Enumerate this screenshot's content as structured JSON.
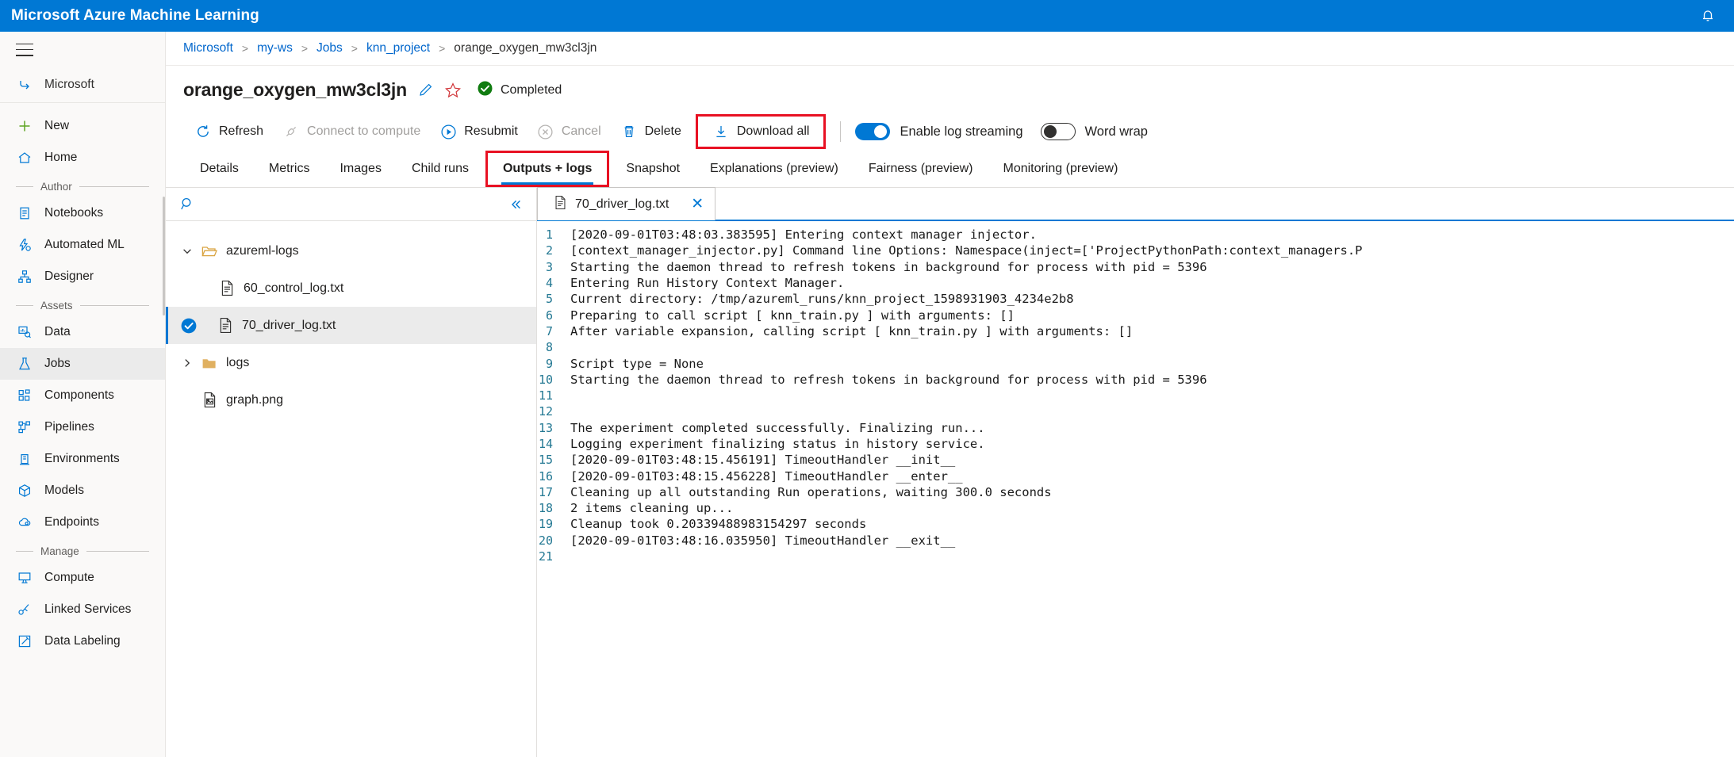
{
  "topbar": {
    "title": "Microsoft Azure Machine Learning",
    "notification_icon": "bell-icon"
  },
  "sidebar": {
    "menu_icon": "hamburger-icon",
    "back_label": "Microsoft",
    "items": [
      {
        "label": "New",
        "icon": "plus-icon"
      },
      {
        "label": "Home",
        "icon": "home-icon"
      }
    ],
    "groups": [
      {
        "caption": "Author",
        "items": [
          {
            "label": "Notebooks",
            "icon": "notebook-icon"
          },
          {
            "label": "Automated ML",
            "icon": "automated-ml-icon"
          },
          {
            "label": "Designer",
            "icon": "designer-icon"
          }
        ]
      },
      {
        "caption": "Assets",
        "items": [
          {
            "label": "Data",
            "icon": "data-icon"
          },
          {
            "label": "Jobs",
            "icon": "jobs-flask-icon"
          },
          {
            "label": "Components",
            "icon": "components-icon"
          },
          {
            "label": "Pipelines",
            "icon": "pipelines-icon"
          },
          {
            "label": "Environments",
            "icon": "environments-icon"
          },
          {
            "label": "Models",
            "icon": "models-cube-icon"
          },
          {
            "label": "Endpoints",
            "icon": "endpoints-cloud-icon"
          }
        ]
      },
      {
        "caption": "Manage",
        "items": [
          {
            "label": "Compute",
            "icon": "compute-monitor-icon"
          },
          {
            "label": "Linked Services",
            "icon": "linked-services-icon"
          },
          {
            "label": "Data Labeling",
            "icon": "data-labeling-icon"
          }
        ]
      }
    ],
    "active_item": "Jobs"
  },
  "breadcrumb": {
    "items": [
      "Microsoft",
      "my-ws",
      "Jobs",
      "knn_project",
      "orange_oxygen_mw3cl3jn"
    ],
    "separator": ">"
  },
  "job": {
    "title": "orange_oxygen_mw3cl3jn",
    "edit_icon": "pencil-icon",
    "favorite_icon": "star-icon",
    "status_label": "Completed",
    "status_icon": "check-circle-icon",
    "status_color": "#107c10"
  },
  "commandbar": {
    "buttons": [
      {
        "label": "Refresh",
        "icon": "refresh-icon",
        "disabled": false,
        "highlighted": false
      },
      {
        "label": "Connect to compute",
        "icon": "connect-compute-icon",
        "disabled": true,
        "highlighted": false
      },
      {
        "label": "Resubmit",
        "icon": "play-circle-icon",
        "disabled": false,
        "highlighted": false
      },
      {
        "label": "Cancel",
        "icon": "cancel-circle-icon",
        "disabled": true,
        "highlighted": false
      },
      {
        "label": "Delete",
        "icon": "trash-icon",
        "disabled": false,
        "highlighted": false
      },
      {
        "label": "Download all",
        "icon": "download-icon",
        "disabled": false,
        "highlighted": true
      }
    ],
    "highlight_color": "#e81123",
    "toggles": [
      {
        "label": "Enable log streaming",
        "state": "on"
      },
      {
        "label": "Word wrap",
        "state": "off"
      }
    ]
  },
  "tabs": {
    "items": [
      {
        "label": "Details",
        "active": false,
        "highlighted": false
      },
      {
        "label": "Metrics",
        "active": false,
        "highlighted": false
      },
      {
        "label": "Images",
        "active": false,
        "highlighted": false
      },
      {
        "label": "Child runs",
        "active": false,
        "highlighted": false
      },
      {
        "label": "Outputs + logs",
        "active": true,
        "highlighted": true
      },
      {
        "label": "Snapshot",
        "active": false,
        "highlighted": false
      },
      {
        "label": "Explanations (preview)",
        "active": false,
        "highlighted": false
      },
      {
        "label": "Fairness (preview)",
        "active": false,
        "highlighted": false
      },
      {
        "label": "Monitoring (preview)",
        "active": false,
        "highlighted": false
      }
    ]
  },
  "filepane": {
    "search": {
      "placeholder": "",
      "value": "",
      "icon": "search-icon"
    },
    "collapse_icon": "double-chevron-left-icon",
    "tree": [
      {
        "label": "azureml-logs",
        "type": "folder",
        "depth": 0,
        "expanded": true,
        "selected": false,
        "checked": false
      },
      {
        "label": "60_control_log.txt",
        "type": "file",
        "depth": 1,
        "expanded": null,
        "selected": false,
        "checked": false
      },
      {
        "label": "70_driver_log.txt",
        "type": "file",
        "depth": 1,
        "expanded": null,
        "selected": true,
        "checked": true
      },
      {
        "label": "logs",
        "type": "folder",
        "depth": 0,
        "expanded": false,
        "selected": false,
        "checked": false
      },
      {
        "label": "graph.png",
        "type": "image",
        "depth": 0,
        "expanded": null,
        "selected": false,
        "checked": false
      }
    ]
  },
  "logviewer": {
    "open_tab": {
      "label": "70_driver_log.txt",
      "icon": "file-icon",
      "close_icon": "close-icon"
    },
    "lines": [
      {
        "n": 1,
        "text": "[2020-09-01T03:48:03.383595] Entering context manager injector."
      },
      {
        "n": 2,
        "text": "[context_manager_injector.py] Command line Options: Namespace(inject=['ProjectPythonPath:context_managers.P"
      },
      {
        "n": 3,
        "text": "Starting the daemon thread to refresh tokens in background for process with pid = 5396"
      },
      {
        "n": 4,
        "text": "Entering Run History Context Manager."
      },
      {
        "n": 5,
        "text": "Current directory:  /tmp/azureml_runs/knn_project_1598931903_4234e2b8"
      },
      {
        "n": 6,
        "text": "Preparing to call script [ knn_train.py ] with arguments: []"
      },
      {
        "n": 7,
        "text": "After variable expansion, calling script [ knn_train.py ] with arguments: []"
      },
      {
        "n": 8,
        "text": ""
      },
      {
        "n": 9,
        "text": "Script type = None"
      },
      {
        "n": 10,
        "text": "Starting the daemon thread to refresh tokens in background for process with pid = 5396"
      },
      {
        "n": 11,
        "text": ""
      },
      {
        "n": 12,
        "text": ""
      },
      {
        "n": 13,
        "text": "The experiment completed successfully. Finalizing run..."
      },
      {
        "n": 14,
        "text": "Logging experiment finalizing status in history service."
      },
      {
        "n": 15,
        "text": "[2020-09-01T03:48:15.456191] TimeoutHandler __init__"
      },
      {
        "n": 16,
        "text": "[2020-09-01T03:48:15.456228] TimeoutHandler __enter__"
      },
      {
        "n": 17,
        "text": "Cleaning up all outstanding Run operations, waiting 300.0 seconds"
      },
      {
        "n": 18,
        "text": "2 items cleaning up..."
      },
      {
        "n": 19,
        "text": "Cleanup took 0.20339488983154297 seconds"
      },
      {
        "n": 20,
        "text": "[2020-09-01T03:48:16.035950] TimeoutHandler __exit__"
      },
      {
        "n": 21,
        "text": ""
      }
    ]
  },
  "colors": {
    "brand_blue": "#0078d4",
    "link_blue": "#0066cc",
    "success_green": "#107c10",
    "highlight_red": "#e81123",
    "line_number": "#237893"
  }
}
